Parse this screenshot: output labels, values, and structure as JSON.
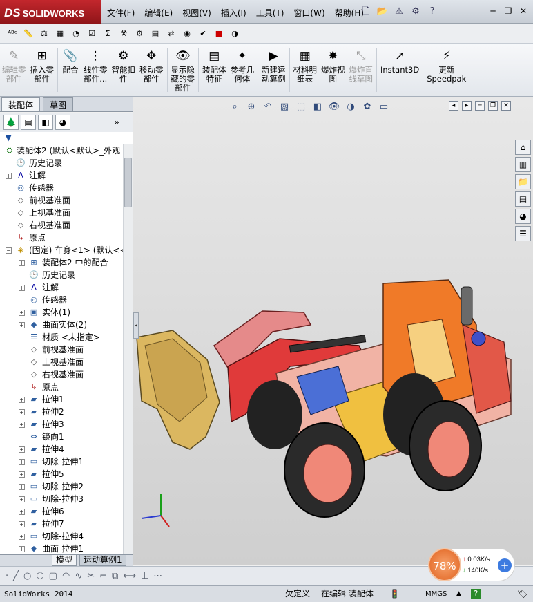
{
  "app": {
    "brand_prefix": "DS",
    "brand": "SOLIDWORKS"
  },
  "menu": [
    "文件(F)",
    "编辑(E)",
    "视图(V)",
    "插入(I)",
    "工具(T)",
    "窗口(W)",
    "帮助(H)"
  ],
  "ribbon": [
    {
      "label": "编辑零\n部件",
      "icon": "edit-component-icon",
      "disabled": true
    },
    {
      "label": "插入零\n部件",
      "icon": "insert-component-icon",
      "disabled": false
    },
    {
      "label": "配合",
      "icon": "mate-icon",
      "disabled": false
    },
    {
      "label": "线性零\n部件...",
      "icon": "linear-pattern-icon",
      "disabled": false
    },
    {
      "label": "智能扣\n件",
      "icon": "smart-fastener-icon",
      "disabled": false
    },
    {
      "label": "移动零\n部件",
      "icon": "move-component-icon",
      "disabled": false
    },
    {
      "label": "显示隐\n藏的零\n部件",
      "icon": "show-hidden-icon",
      "disabled": false
    },
    {
      "label": "装配体\n特征",
      "icon": "assembly-feature-icon",
      "disabled": false
    },
    {
      "label": "参考几\n何体",
      "icon": "reference-geometry-icon",
      "disabled": false
    },
    {
      "label": "新建运\n动算例",
      "icon": "new-motion-study-icon",
      "disabled": false
    },
    {
      "label": "材料明\n细表",
      "icon": "bom-icon",
      "disabled": false
    },
    {
      "label": "爆炸视\n图",
      "icon": "exploded-view-icon",
      "disabled": false
    },
    {
      "label": "爆炸直\n线草图",
      "icon": "explode-line-sketch-icon",
      "disabled": true
    },
    {
      "label": "Instant3D",
      "icon": "instant3d-icon",
      "disabled": false
    },
    {
      "label": "更新\nSpeedpak",
      "icon": "speedpak-icon",
      "disabled": false
    }
  ],
  "fm_tabs": {
    "assembly": "装配体",
    "sketch": "草图"
  },
  "tree": [
    {
      "label": "装配体2  (默认<默认>_外观",
      "indent": 0,
      "expander": "",
      "icon": "assembly-icon"
    },
    {
      "label": "历史记录",
      "indent": 1,
      "expander": "",
      "icon": "history-icon"
    },
    {
      "label": "注解",
      "indent": 1,
      "expander": "+",
      "icon": "annotation-icon"
    },
    {
      "label": "传感器",
      "indent": 1,
      "expander": "",
      "icon": "sensor-icon"
    },
    {
      "label": "前视基准面",
      "indent": 1,
      "expander": "",
      "icon": "plane-icon"
    },
    {
      "label": "上视基准面",
      "indent": 1,
      "expander": "",
      "icon": "plane-icon"
    },
    {
      "label": "右视基准面",
      "indent": 1,
      "expander": "",
      "icon": "plane-icon"
    },
    {
      "label": "原点",
      "indent": 1,
      "expander": "",
      "icon": "origin-icon"
    },
    {
      "label": "(固定) 车身<1> (默认<<",
      "indent": 1,
      "expander": "-",
      "icon": "part-icon"
    },
    {
      "label": "装配体2 中的配合",
      "indent": 2,
      "expander": "+",
      "icon": "mates-folder-icon"
    },
    {
      "label": "历史记录",
      "indent": 2,
      "expander": "",
      "icon": "history-icon"
    },
    {
      "label": "注解",
      "indent": 2,
      "expander": "+",
      "icon": "annotation-icon"
    },
    {
      "label": "传感器",
      "indent": 2,
      "expander": "",
      "icon": "sensor-icon"
    },
    {
      "label": "实体(1)",
      "indent": 2,
      "expander": "+",
      "icon": "solid-body-icon"
    },
    {
      "label": "曲面实体(2)",
      "indent": 2,
      "expander": "+",
      "icon": "surface-body-icon"
    },
    {
      "label": "材质 <未指定>",
      "indent": 2,
      "expander": "",
      "icon": "material-icon"
    },
    {
      "label": "前视基准面",
      "indent": 2,
      "expander": "",
      "icon": "plane-icon"
    },
    {
      "label": "上视基准面",
      "indent": 2,
      "expander": "",
      "icon": "plane-icon"
    },
    {
      "label": "右视基准面",
      "indent": 2,
      "expander": "",
      "icon": "plane-icon"
    },
    {
      "label": "原点",
      "indent": 2,
      "expander": "",
      "icon": "origin-icon"
    },
    {
      "label": "拉伸1",
      "indent": 2,
      "expander": "+",
      "icon": "extrude-icon"
    },
    {
      "label": "拉伸2",
      "indent": 2,
      "expander": "+",
      "icon": "extrude-icon"
    },
    {
      "label": "拉伸3",
      "indent": 2,
      "expander": "+",
      "icon": "extrude-icon"
    },
    {
      "label": "镜向1",
      "indent": 2,
      "expander": "",
      "icon": "mirror-icon"
    },
    {
      "label": "拉伸4",
      "indent": 2,
      "expander": "+",
      "icon": "extrude-icon"
    },
    {
      "label": "切除-拉伸1",
      "indent": 2,
      "expander": "+",
      "icon": "cut-extrude-icon"
    },
    {
      "label": "拉伸5",
      "indent": 2,
      "expander": "+",
      "icon": "extrude-icon"
    },
    {
      "label": "切除-拉伸2",
      "indent": 2,
      "expander": "+",
      "icon": "cut-extrude-icon"
    },
    {
      "label": "切除-拉伸3",
      "indent": 2,
      "expander": "+",
      "icon": "cut-extrude-icon"
    },
    {
      "label": "拉伸6",
      "indent": 2,
      "expander": "+",
      "icon": "extrude-icon"
    },
    {
      "label": "拉伸7",
      "indent": 2,
      "expander": "+",
      "icon": "extrude-icon"
    },
    {
      "label": "切除-拉伸4",
      "indent": 2,
      "expander": "+",
      "icon": "cut-extrude-icon"
    },
    {
      "label": "曲面-拉伸1",
      "indent": 2,
      "expander": "+",
      "icon": "surface-extrude-icon"
    }
  ],
  "bottom_tabs": {
    "model": "模型",
    "motion": "运动算例1"
  },
  "status": {
    "app": "SolidWorks 2014",
    "underdefined": "欠定义",
    "editing": "在编辑 装配体",
    "units": "MMGS"
  },
  "network": {
    "percent": "78%",
    "up": "0.03K/s",
    "down": "140K/s"
  },
  "colors": {
    "logo_red": "#b3191e",
    "net_orange": "#e8712a"
  }
}
